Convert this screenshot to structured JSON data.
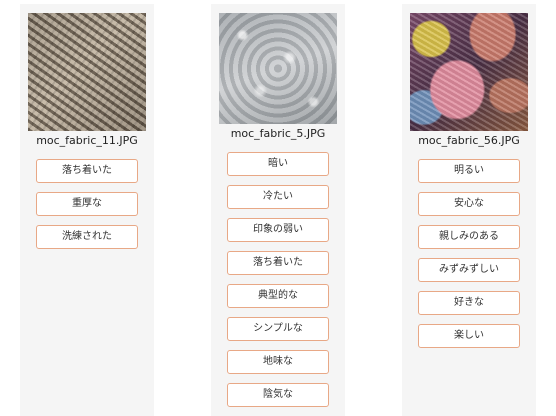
{
  "items": [
    {
      "filename": "moc_fabric_11.JPG",
      "tags": [
        "落ち着いた",
        "重厚な",
        "洗練された"
      ]
    },
    {
      "filename": "moc_fabric_5.JPG",
      "tags": [
        "暗い",
        "冷たい",
        "印象の弱い",
        "落ち着いた",
        "典型的な",
        "シンプルな",
        "地味な",
        "陰気な"
      ]
    },
    {
      "filename": "moc_fabric_56.JPG",
      "tags": [
        "明るい",
        "安心な",
        "親しみのある",
        "みずみずしい",
        "好きな",
        "楽しい"
      ]
    }
  ],
  "colors": {
    "tag_border": "#e8a886",
    "card_bg": "#f5f5f5"
  }
}
